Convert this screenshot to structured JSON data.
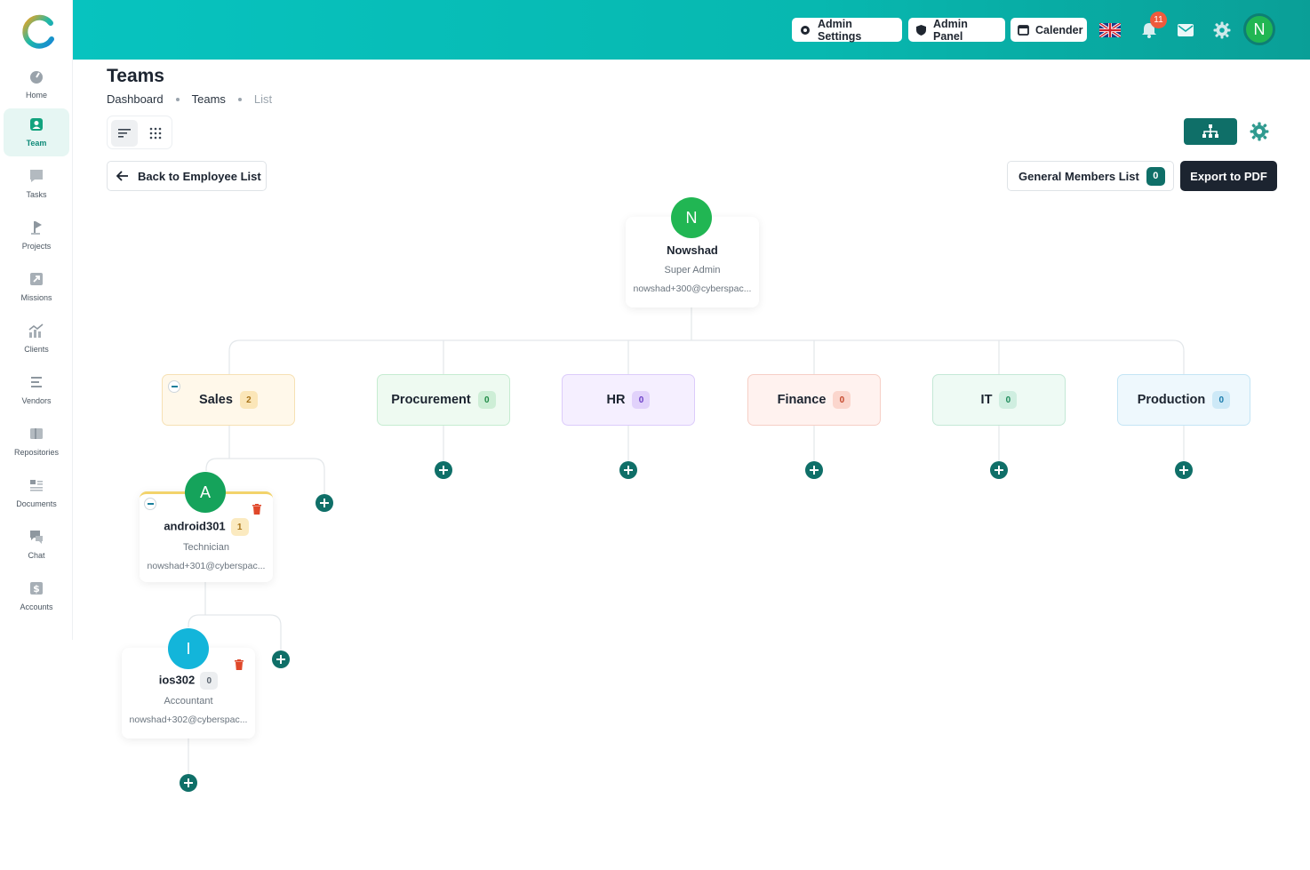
{
  "header": {
    "admin_settings": "Admin Settings",
    "admin_panel": "Admin Panel",
    "calender": "Calender",
    "notification_count": "11",
    "user_initial": "N",
    "colors": {
      "gradient_start": "#07c3bf",
      "gradient_end": "#0a9f97",
      "badge": "#ef5a3c"
    }
  },
  "sidebar": {
    "items": [
      {
        "label": "Home",
        "icon": "gauge-icon"
      },
      {
        "label": "Team",
        "icon": "user-badge-icon",
        "active": true
      },
      {
        "label": "Tasks",
        "icon": "chat-square-icon"
      },
      {
        "label": "Projects",
        "icon": "flag-icon"
      },
      {
        "label": "Missions",
        "icon": "arrow-up-right-icon"
      },
      {
        "label": "Clients",
        "icon": "chart-icon"
      },
      {
        "label": "Vendors",
        "icon": "list-icon"
      },
      {
        "label": "Repositories",
        "icon": "folder-icon"
      },
      {
        "label": "Documents",
        "icon": "document-icon"
      },
      {
        "label": "Chat",
        "icon": "chat-icon"
      },
      {
        "label": "Accounts",
        "icon": "dollar-icon"
      }
    ]
  },
  "page": {
    "title": "Teams",
    "breadcrumb": [
      "Dashboard",
      "Teams",
      "List"
    ]
  },
  "actions": {
    "back": "Back to Employee List",
    "general_members": "General Members List",
    "general_members_count": "0",
    "export": "Export to PDF"
  },
  "root": {
    "initial": "N",
    "name": "Nowshad",
    "role": "Super Admin",
    "email": "nowshad+300@cyberspac..."
  },
  "departments": [
    {
      "name": "Sales",
      "count": "2",
      "bg": "#fff8ea",
      "border": "#f6e1b4",
      "badge_bg": "#fbe6b8",
      "badge_fg": "#a8741a"
    },
    {
      "name": "Procurement",
      "count": "0",
      "bg": "#eefaf1",
      "border": "#c6ecd1",
      "badge_bg": "#cdeed6",
      "badge_fg": "#1f8a45"
    },
    {
      "name": "HR",
      "count": "0",
      "bg": "#f5efff",
      "border": "#dcccfb",
      "badge_bg": "#e1d2fb",
      "badge_fg": "#6b3fc7"
    },
    {
      "name": "Finance",
      "count": "0",
      "bg": "#fff2ef",
      "border": "#f6cfc6",
      "badge_bg": "#fbd6cd",
      "badge_fg": "#c4462a"
    },
    {
      "name": "IT",
      "count": "0",
      "bg": "#eefaf4",
      "border": "#c4e8d6",
      "badge_bg": "#cfeee0",
      "badge_fg": "#1d8a5a"
    },
    {
      "name": "Production",
      "count": "0",
      "bg": "#eef8fd",
      "border": "#c4e5f5",
      "badge_bg": "#cde9f7",
      "badge_fg": "#1a7bab"
    }
  ],
  "members": [
    {
      "initial": "A",
      "name": "android301",
      "count": "1",
      "role": "Technician",
      "email": "nowshad+301@cyberspac...",
      "color": "#15a35b"
    },
    {
      "initial": "I",
      "name": "ios302",
      "count": "0",
      "role": "Accountant",
      "email": "nowshad+302@cyberspac...",
      "color": "#13b5da"
    }
  ]
}
